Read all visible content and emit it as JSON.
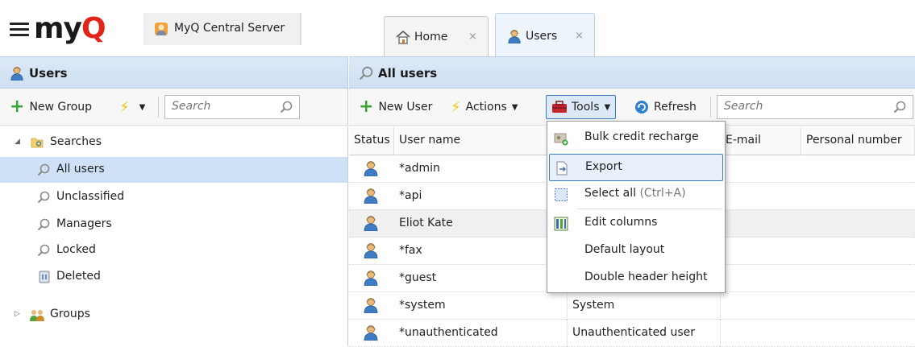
{
  "app": {
    "logo_text": "my",
    "logo_q": "Q",
    "server_label": "MyQ Central Server"
  },
  "tabs": [
    {
      "label": "Home",
      "close": "×"
    },
    {
      "label": "Users",
      "close": "×"
    }
  ],
  "left_panel": {
    "title": "Users",
    "toolbar": {
      "new_group": "New Group",
      "search_placeholder": "Search"
    },
    "tree": {
      "searches": "Searches",
      "items": [
        "All users",
        "Unclassified",
        "Managers",
        "Locked",
        "Deleted"
      ],
      "groups": "Groups"
    }
  },
  "right_panel": {
    "title": "All users",
    "toolbar": {
      "new_user": "New User",
      "actions": "Actions",
      "tools": "Tools",
      "refresh": "Refresh",
      "search_placeholder": "Search"
    },
    "columns": [
      "Status",
      "User name",
      "",
      "E-mail",
      "Personal number"
    ],
    "rows": [
      {
        "username": "*admin",
        "fullname": ""
      },
      {
        "username": "*api",
        "fullname": ""
      },
      {
        "username": "Eliot Kate",
        "fullname": ""
      },
      {
        "username": "*fax",
        "fullname": ""
      },
      {
        "username": "*guest",
        "fullname": ""
      },
      {
        "username": "*system",
        "fullname": "System"
      },
      {
        "username": "*unauthenticated",
        "fullname": "Unauthenticated user"
      }
    ]
  },
  "tools_menu": {
    "bulk_credit": "Bulk credit recharge",
    "export": "Export",
    "select_all": "Select all",
    "select_all_shortcut": "(Ctrl+A)",
    "edit_columns": "Edit columns",
    "default_layout": "Default layout",
    "double_header": "Double header height"
  },
  "colors": {
    "accent": "#3c7ac0",
    "header_bg": "#cfe0f3",
    "selection": "#cfe1f7",
    "logo_red": "#e2231a",
    "add_green": "#3aa43a"
  }
}
